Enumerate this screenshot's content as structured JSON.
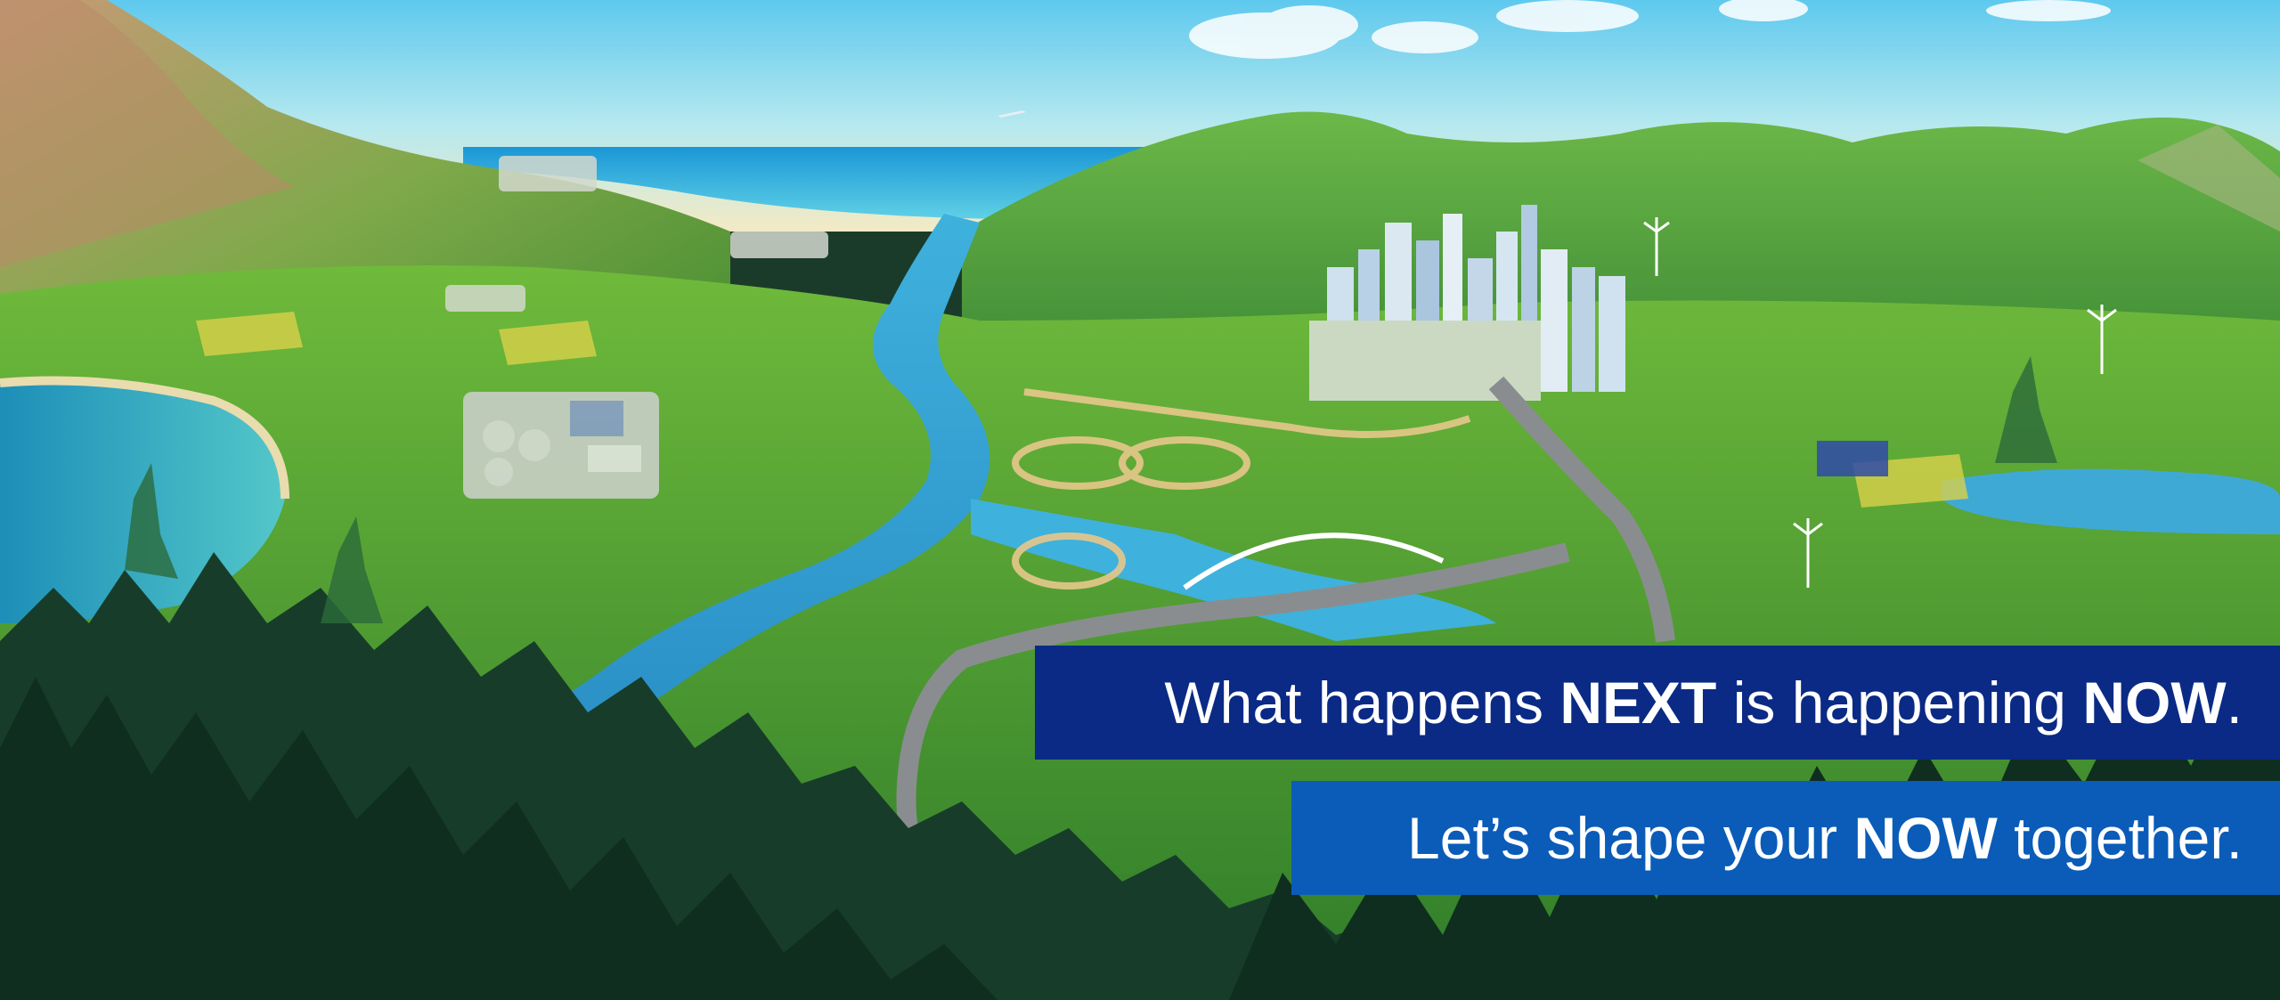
{
  "banner": {
    "line1": {
      "part1": "What happens ",
      "part2": "NEXT",
      "part3": " is happening ",
      "part4": "NOW",
      "part5": "."
    },
    "line2": {
      "part1": "Let’s shape your ",
      "part2": "NOW",
      "part3": " together."
    }
  },
  "colors": {
    "banner_primary": "#0a2a85",
    "banner_secondary": "#0a5cb8",
    "text": "#ffffff"
  }
}
